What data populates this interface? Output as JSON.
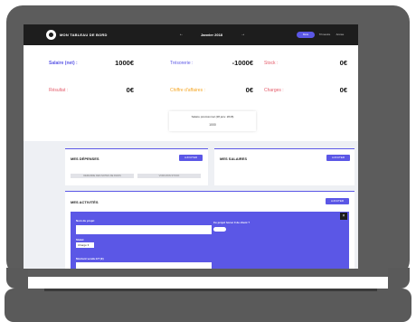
{
  "header": {
    "brand": "MON TABLEAU DE BORD",
    "prev_icon": "chevron-left-icon",
    "prev_label": "←",
    "period": "Janvier 2018",
    "next_icon": "chevron-right-icon",
    "next_label": "→",
    "tabs": [
      "Mois",
      "Trimestre",
      "Année"
    ]
  },
  "stats": [
    {
      "label": "Salaire (net) :",
      "value": "1000€",
      "color": "#5b57e6"
    },
    {
      "label": "Trésorerie :",
      "value": "-1000€",
      "color": "#5b57e6"
    },
    {
      "label": "Stock :",
      "value": "0€",
      "color": "#e45b6a"
    },
    {
      "label": "Résultat :",
      "value": "0€",
      "color": "#e45b6a"
    },
    {
      "label": "Chiffre d'affaires :",
      "value": "0€",
      "color": "#f5a623"
    },
    {
      "label": "Charges :",
      "value": "0€",
      "color": "#e45b6a"
    }
  ],
  "simulation": {
    "title": "Salaire prévisionnel (28 janv. 2018)",
    "value": "1000"
  },
  "expenses": {
    "title": "MES DÉPENSES",
    "add_label": "AJOUTER",
    "buttons": [
      "DEMANDE DES NOTES DE FRAIS",
      "VOIR MON STOCK"
    ]
  },
  "salaries": {
    "title": "MES SALAIRES",
    "add_label": "AJOUTER"
  },
  "activities": {
    "title": "MES ACTIVITÉS",
    "add_label": "AJOUTER",
    "form": {
      "project_name_label": "Nom du projet",
      "paid_question": "Ce projet horsé 0 de client ?",
      "status_label": "Statut",
      "status_value": "Chargé",
      "amount_label": "Montant vendu HT (€)",
      "close_label": "×"
    }
  },
  "colors": {
    "accent": "#5b57e6",
    "topbar": "#1d1d1d"
  }
}
